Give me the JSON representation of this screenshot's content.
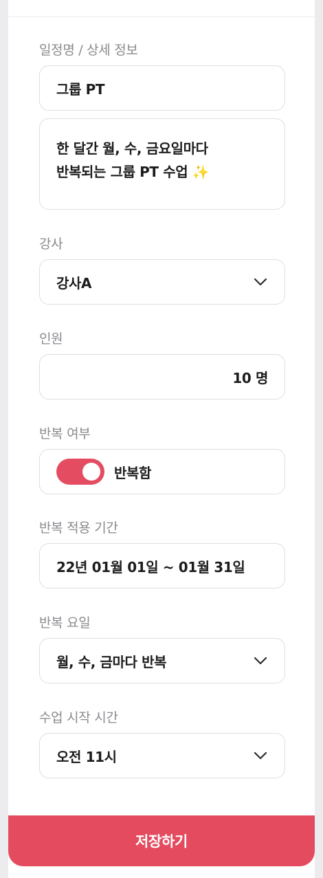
{
  "form": {
    "title_detail": {
      "label": "일정명 / 상세 정보",
      "name_value": "그룹 PT",
      "detail_line1": "한 달간 월, 수, 금요일마다",
      "detail_line2": "반복되는 그룹 PT 수업 ✨"
    },
    "instructor": {
      "label": "강사",
      "value": "강사A"
    },
    "capacity": {
      "label": "인원",
      "value": "10 명"
    },
    "repeat": {
      "label": "반복 여부",
      "toggle_on": true,
      "toggle_label": "반복함"
    },
    "repeat_period": {
      "label": "반복 적용 기간",
      "value": "22년 01월 01일 ~ 01월 31일"
    },
    "repeat_days": {
      "label": "반복 요일",
      "value": "월, 수, 금마다 반복"
    },
    "start_time": {
      "label": "수업 시작 시간",
      "value": "오전 11시"
    }
  },
  "actions": {
    "save_label": "저장하기"
  },
  "colors": {
    "accent": "#e44b5f",
    "border": "#dedee2",
    "label": "#8a8a8f"
  },
  "icons": {
    "dropdown": "chevron-down-icon"
  }
}
